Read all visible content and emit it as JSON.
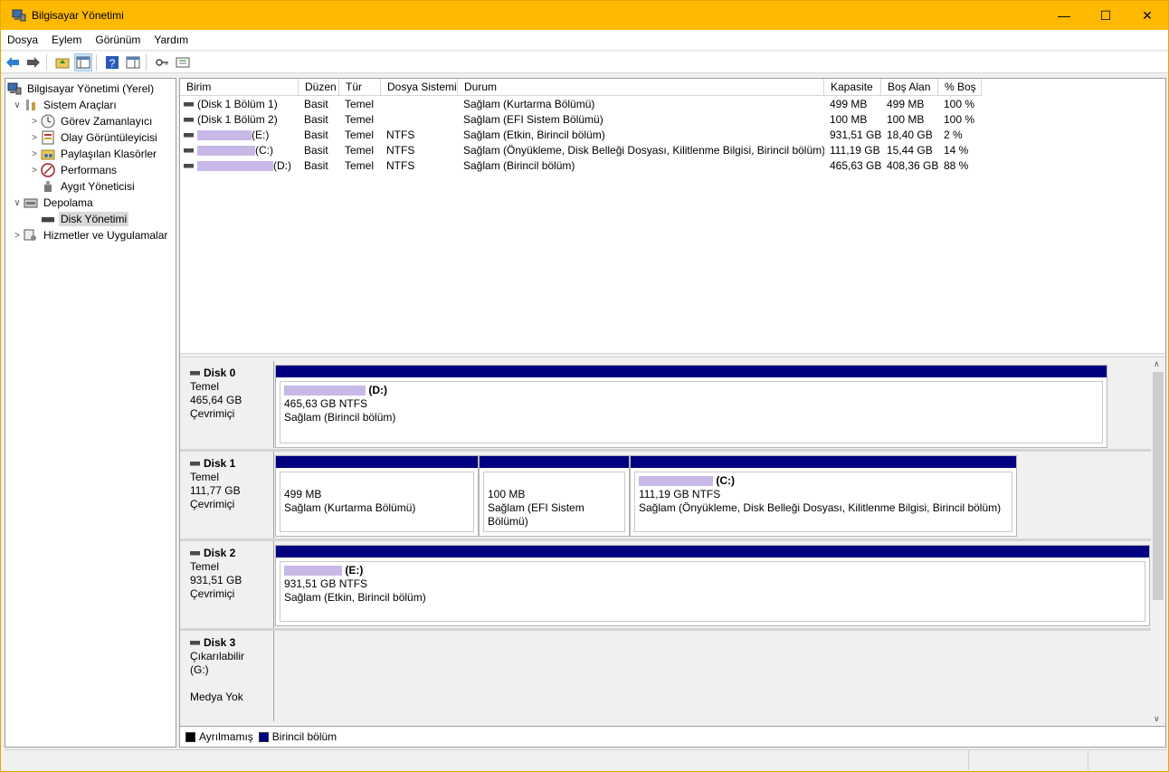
{
  "window": {
    "title": "Bilgisayar Yönetimi"
  },
  "menu": [
    "Dosya",
    "Eylem",
    "Görünüm",
    "Yardım"
  ],
  "tree": [
    {
      "label": "Bilgisayar Yönetimi (Yerel)",
      "icon": "computer-management-icon",
      "level": 0,
      "arrow": ""
    },
    {
      "label": "Sistem Araçları",
      "icon": "tools-icon",
      "level": 1,
      "arrow": "v"
    },
    {
      "label": "Görev Zamanlayıcı",
      "icon": "clock-icon",
      "level": 2,
      "arrow": ">"
    },
    {
      "label": "Olay Görüntüleyicisi",
      "icon": "event-viewer-icon",
      "level": 2,
      "arrow": ">"
    },
    {
      "label": "Paylaşılan Klasörler",
      "icon": "shared-folder-icon",
      "level": 2,
      "arrow": ">"
    },
    {
      "label": "Performans",
      "icon": "performance-icon",
      "level": 2,
      "arrow": ">"
    },
    {
      "label": "Aygıt Yöneticisi",
      "icon": "device-manager-icon",
      "level": 2,
      "arrow": ""
    },
    {
      "label": "Depolama",
      "icon": "storage-icon",
      "level": 1,
      "arrow": "v"
    },
    {
      "label": "Disk Yönetimi",
      "icon": "disk-management-icon",
      "level": 2,
      "arrow": "",
      "selected": true
    },
    {
      "label": "Hizmetler ve Uygulamalar",
      "icon": "services-icon",
      "level": 1,
      "arrow": ">"
    }
  ],
  "volumes": {
    "headers": [
      "Birim",
      "Düzen",
      "Tür",
      "Dosya Sistemi",
      "Durum",
      "Kapasite",
      "Boş Alan",
      "% Boş"
    ],
    "rows": [
      {
        "name": "(Disk 1 Bölüm 1)",
        "layout": "Basit",
        "type": "Temel",
        "fs": "",
        "status": "Sağlam (Kurtarma Bölümü)",
        "capacity": "499 MB",
        "free": "499 MB",
        "pct": "100 %"
      },
      {
        "name": "(Disk 1 Bölüm 2)",
        "layout": "Basit",
        "type": "Temel",
        "fs": "",
        "status": "Sağlam (EFI Sistem Bölümü)",
        "capacity": "100 MB",
        "free": "100 MB",
        "pct": "100 %"
      },
      {
        "name": "(E:)",
        "layout": "Basit",
        "type": "Temel",
        "fs": "NTFS",
        "status": "Sağlam (Etkin, Birincil bölüm)",
        "capacity": "931,51 GB",
        "free": "18,40 GB",
        "pct": "2 %"
      },
      {
        "name": "(C:)",
        "layout": "Basit",
        "type": "Temel",
        "fs": "NTFS",
        "status": "Sağlam (Önyükleme, Disk Belleği Dosyası, Kilitlenme Bilgisi, Birincil bölüm)",
        "capacity": "111,19 GB",
        "free": "15,44 GB",
        "pct": "14 %"
      },
      {
        "name": "(D:)",
        "layout": "Basit",
        "type": "Temel",
        "fs": "NTFS",
        "status": "Sağlam (Birincil bölüm)",
        "capacity": "465,63 GB",
        "free": "408,36 GB",
        "pct": "88 %"
      }
    ]
  },
  "disks": [
    {
      "name": "Disk 0",
      "type": "Temel",
      "size": "465,64 GB",
      "state": "Çevrimiçi",
      "partitions": [
        {
          "label": "(D:)",
          "line1": "465,63 GB NTFS",
          "line2": "Sağlam (Birincil bölüm)"
        }
      ]
    },
    {
      "name": "Disk 1",
      "type": "Temel",
      "size": "111,77 GB",
      "state": "Çevrimiçi",
      "partitions": [
        {
          "label": "",
          "line1": "499 MB",
          "line2": "Sağlam (Kurtarma Bölümü)"
        },
        {
          "label": "",
          "line1": "100 MB",
          "line2": "Sağlam (EFI Sistem Bölümü)"
        },
        {
          "label": "(C:)",
          "line1": "111,19 GB NTFS",
          "line2": "Sağlam (Önyükleme, Disk Belleği Dosyası, Kilitlenme Bilgisi, Birincil bölüm)"
        }
      ]
    },
    {
      "name": "Disk 2",
      "type": "Temel",
      "size": "931,51 GB",
      "state": "Çevrimiçi",
      "partitions": [
        {
          "label": "(E:)",
          "line1": "931,51 GB NTFS",
          "line2": "Sağlam (Etkin, Birincil bölüm)"
        }
      ]
    },
    {
      "name": "Disk 3",
      "type": "Çıkarılabilir (G:)",
      "size": "",
      "state": "Medya Yok",
      "partitions": []
    }
  ],
  "legend": [
    {
      "label": "Ayrılmamış",
      "color": "#000000"
    },
    {
      "label": "Birincil bölüm",
      "color": "#000080"
    }
  ],
  "colors": {
    "titlebar": "#ffb900",
    "partition": "#000080"
  }
}
